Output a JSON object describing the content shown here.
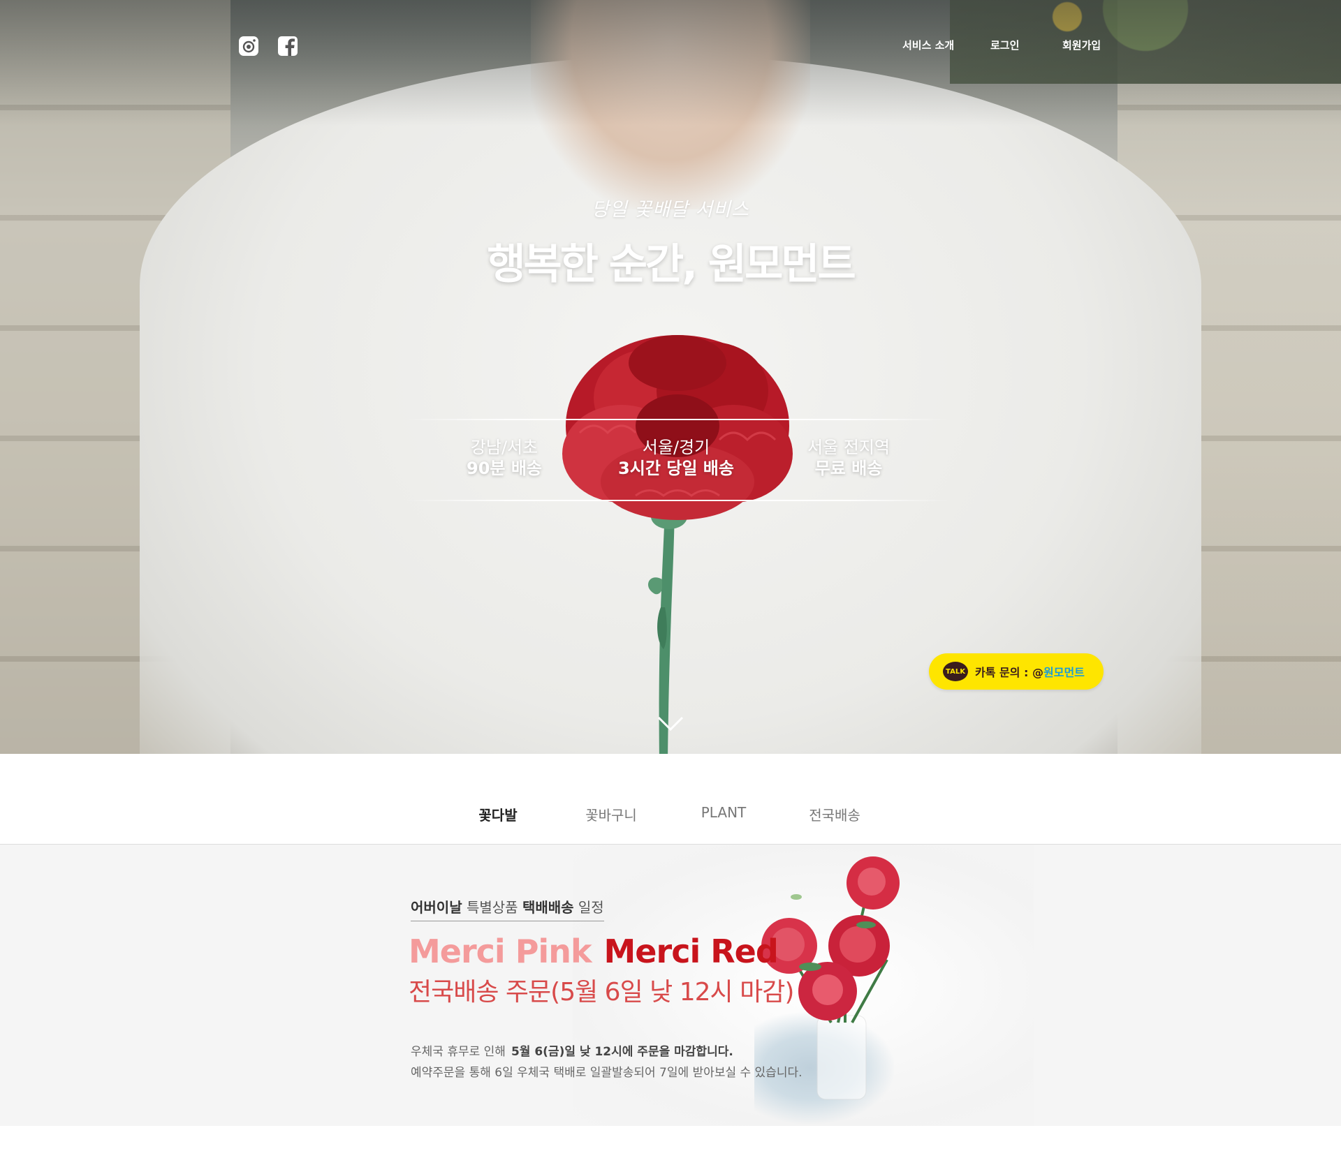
{
  "header": {
    "social": [
      {
        "icon": "instagram-icon"
      },
      {
        "icon": "facebook-icon"
      }
    ],
    "nav": [
      "서비스 소개",
      "로그인",
      "회원가입"
    ]
  },
  "hero": {
    "tagline": "당일 꽃배달 서비스",
    "headline": "행복한 순간, 원모먼트",
    "features": [
      {
        "line1": "강남/서초",
        "line2": "90분 배송"
      },
      {
        "line1": "서울/경기",
        "line2": "3시간 당일 배송"
      },
      {
        "line1": "서울 전지역",
        "line2": "무료 배송"
      }
    ],
    "kakao": {
      "badge": "TALK",
      "label": "카톡 문의 : @",
      "handle": "원모먼트"
    }
  },
  "tabs": [
    "꽃다발",
    "꽃바구니",
    "PLANT",
    "전국배송"
  ],
  "promo": {
    "heading_a": "어버이날",
    "heading_b": "특별상품",
    "heading_c": "택배배송",
    "heading_d": "일정",
    "name_pink": "Merci Pink",
    "name_red": "Merci Red",
    "subhead": "전국배송 주문(5월 6일 낮 12시 마감)",
    "note1_a": "우체국 휴무로 인해",
    "note1_b": "5월  6(금)일 낮 12시에 주문을 마감합니다.",
    "note2": "예약주문을 통해 6일 우체국 택배로 일괄발송되어 7일에 받아보실 수 있습니다."
  },
  "colors": {
    "kakao_yellow": "#fee500",
    "kakao_link": "#1a9cd8",
    "promo_pink": "#f49b9b",
    "promo_red": "#c8141c",
    "promo_subhead": "#d84a4a"
  }
}
